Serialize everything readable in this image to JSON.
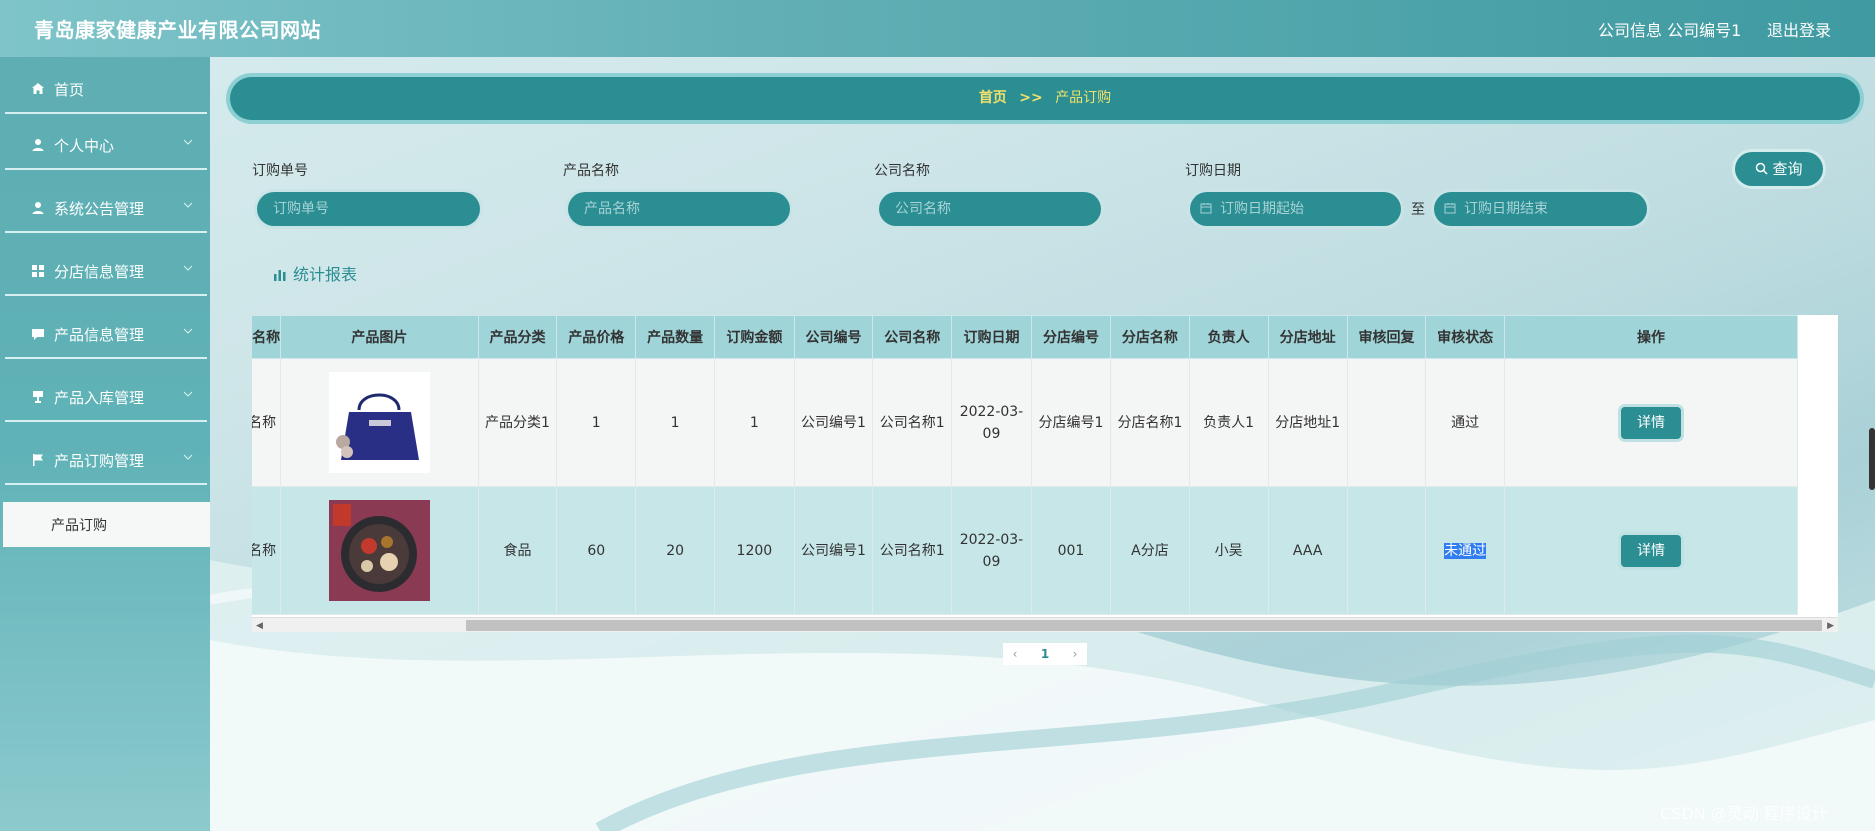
{
  "header": {
    "site_title": "青岛康家健康产业有限公司网站",
    "user_info": "公司信息 公司编号1",
    "logout": "退出登录"
  },
  "sidebar": {
    "items": [
      {
        "label": "首页",
        "icon": "home-icon"
      },
      {
        "label": "个人中心",
        "icon": "user-icon"
      },
      {
        "label": "系统公告管理",
        "icon": "user-icon"
      },
      {
        "label": "分店信息管理",
        "icon": "grid-icon"
      },
      {
        "label": "产品信息管理",
        "icon": "chat-icon"
      },
      {
        "label": "产品入库管理",
        "icon": "trophy-icon"
      },
      {
        "label": "产品订购管理",
        "icon": "flag-icon"
      }
    ],
    "active_sub": "产品订购"
  },
  "breadcrumb": {
    "home": "首页",
    "sep": ">>",
    "current": "产品订购"
  },
  "search": {
    "order_no_label": "订购单号",
    "order_no_placeholder": "订购单号",
    "product_name_label": "产品名称",
    "product_name_placeholder": "产品名称",
    "company_name_label": "公司名称",
    "company_name_placeholder": "公司名称",
    "order_date_label": "订购日期",
    "date_start_placeholder": "订购日期起始",
    "date_to": "至",
    "date_end_placeholder": "订购日期结束",
    "query_label": "查询"
  },
  "stat_report": "统计报表",
  "table": {
    "headers": [
      "名称",
      "产品图片",
      "产品分类",
      "产品价格",
      "产品数量",
      "订购金额",
      "公司编号",
      "公司名称",
      "订购日期",
      "分店编号",
      "分店名称",
      "负责人",
      "分店地址",
      "审核回复",
      "审核状态",
      "操作"
    ],
    "rows": [
      {
        "name": "名称",
        "category": "产品分类1",
        "price": "1",
        "quantity": "1",
        "amount": "1",
        "company_no": "公司编号1",
        "company_name": "公司名称1",
        "order_date": "2022-03-09",
        "branch_no": "分店编号1",
        "branch_name": "分店名称1",
        "manager": "负责人1",
        "branch_addr": "分店地址1",
        "reply": "",
        "status": "通过",
        "action": "详情"
      },
      {
        "name": "名称",
        "category": "食品",
        "price": "60",
        "quantity": "20",
        "amount": "1200",
        "company_no": "公司编号1",
        "company_name": "公司名称1",
        "order_date": "2022-03-09",
        "branch_no": "001",
        "branch_name": "A分店",
        "manager": "小吴",
        "branch_addr": "AAA",
        "reply": "",
        "status": "未通过",
        "action": "详情"
      }
    ]
  },
  "pagination": {
    "prev": "‹",
    "page": "1",
    "next": "›"
  },
  "watermark": "CSDN @灵动 程序设计",
  "colors": {
    "accent": "#2a8e93",
    "breadcrumb_text": "#f3e06b",
    "header_bg": "#3f9aa1"
  }
}
